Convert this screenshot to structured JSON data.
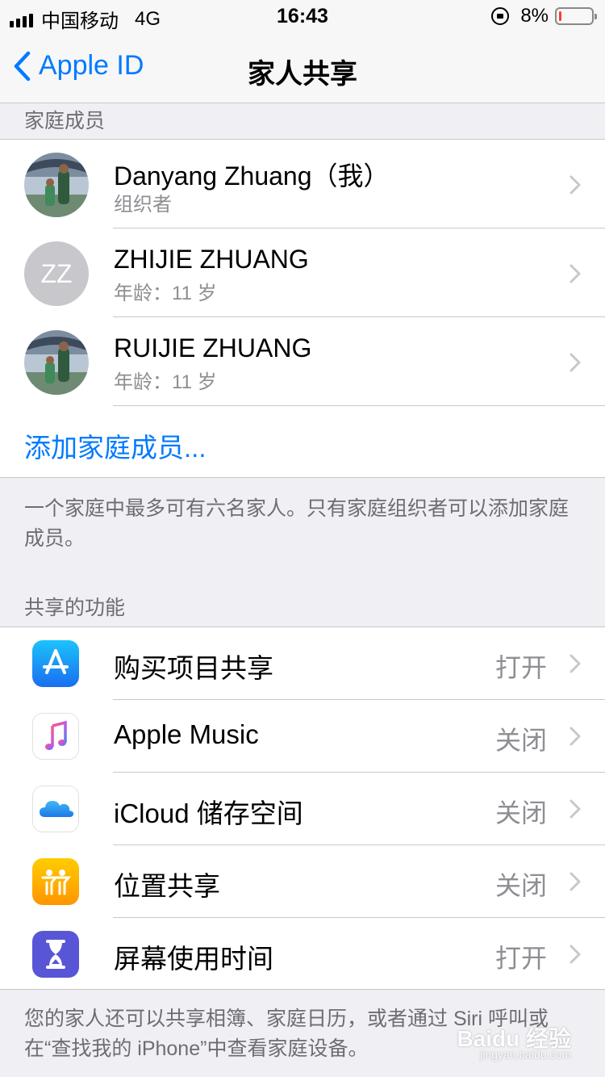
{
  "status_bar": {
    "carrier": "中国移动",
    "network": "4G",
    "time": "16:43",
    "battery": "8%",
    "battery_level": 0.08
  },
  "nav": {
    "back_label": "Apple ID",
    "title": "家人共享"
  },
  "members_section": {
    "header": "家庭成员",
    "members": [
      {
        "name": "Danyang Zhuang（我）",
        "subtitle": "组织者",
        "avatar": "photo"
      },
      {
        "name": "ZHIJIE ZHUANG",
        "subtitle": "年龄：11 岁",
        "avatar": "initials",
        "initials": "ZZ"
      },
      {
        "name": "RUIJIE ZHUANG",
        "subtitle": "年龄：11 岁",
        "avatar": "photo"
      }
    ],
    "add_label": "添加家庭成员...",
    "footer": "一个家庭中最多可有六名家人。只有家庭组织者可以添加家庭成员。"
  },
  "features_section": {
    "header": "共享的功能",
    "features": [
      {
        "label": "购买项目共享",
        "status": "打开",
        "icon": "app-store-icon"
      },
      {
        "label": "Apple Music",
        "status": "关闭",
        "icon": "music-icon"
      },
      {
        "label": "iCloud 储存空间",
        "status": "关闭",
        "icon": "icloud-icon"
      },
      {
        "label": "位置共享",
        "status": "关闭",
        "icon": "find-friends-icon"
      },
      {
        "label": "屏幕使用时间",
        "status": "打开",
        "icon": "screen-time-icon"
      }
    ],
    "footer": "您的家人还可以共享相簿、家庭日历，或者通过 Siri 呼叫或在“查找我的 iPhone”中查看家庭设备。"
  },
  "watermark": {
    "text": "Baidu 经验",
    "sub": "jingyan.baidu.com"
  },
  "colors": {
    "accent": "#007aff",
    "background": "#efeff4",
    "battery_low": "#ff3b30"
  }
}
